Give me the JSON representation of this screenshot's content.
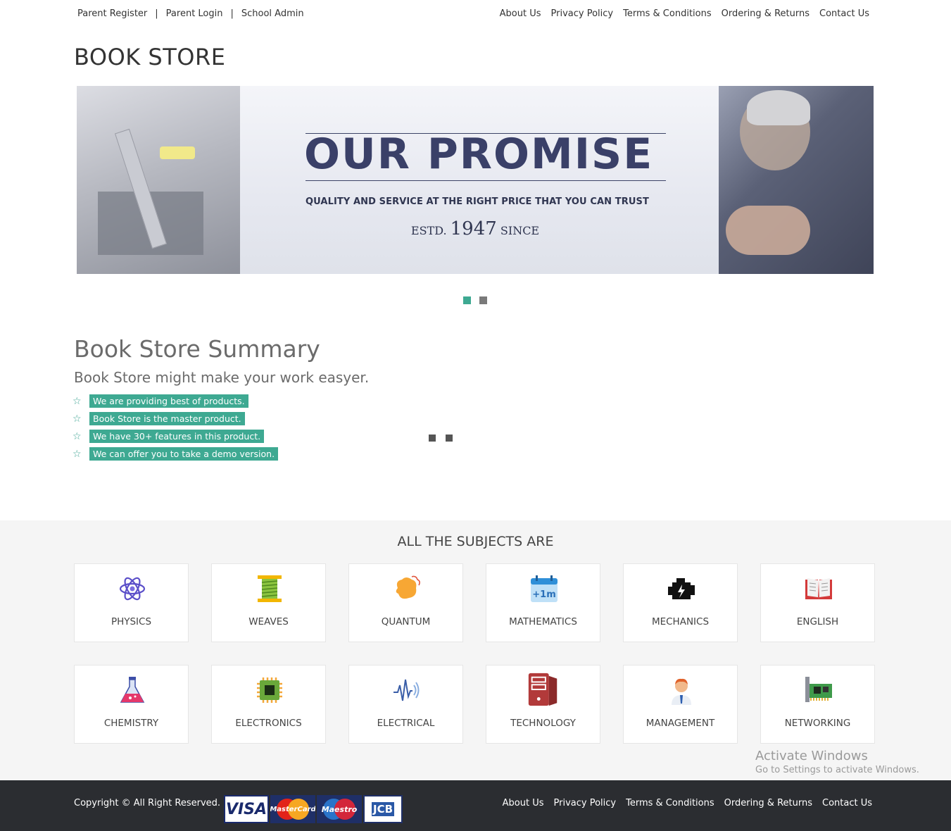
{
  "topbar": {
    "left_links": [
      "Parent Register",
      "Parent Login",
      "School Admin"
    ],
    "separator": "|",
    "right_links": [
      "About Us",
      "Privacy Policy",
      "Terms & Conditions",
      "Ordering & Returns",
      "Contact Us"
    ]
  },
  "brand": "BOOK STORE",
  "banner": {
    "headline": "OUR PROMISE",
    "tagline": "QUALITY AND SERVICE AT THE RIGHT PRICE THAT YOU CAN TRUST",
    "estd_prefix": "ESTD.",
    "year": "1947",
    "estd_suffix": "SINCE",
    "slide_count": 2,
    "active_slide": 1,
    "colors": {
      "active_dot": "#3ea992",
      "inactive_dot": "#7a7a7a"
    }
  },
  "summary": {
    "title": "Book Store Summary",
    "subtitle": "Book Store might make your work easyer.",
    "features": [
      "We are providing best of products.",
      "Book Store is the master product.",
      "We have 30+ features in this product.",
      "We can offer you to take a demo version."
    ],
    "accent": "#3ea992"
  },
  "subjects": {
    "title": "ALL THE SUBJECTS ARE",
    "items": [
      {
        "label": "PHYSICS",
        "icon": "atom-icon"
      },
      {
        "label": "WEAVES",
        "icon": "spool-icon"
      },
      {
        "label": "QUANTUM",
        "icon": "splash-icon"
      },
      {
        "label": "MATHEMATICS",
        "icon": "calendar-plus-icon",
        "icon_text": "+1m"
      },
      {
        "label": "MECHANICS",
        "icon": "engine-icon"
      },
      {
        "label": "ENGLISH",
        "icon": "open-book-icon"
      },
      {
        "label": "CHEMISTRY",
        "icon": "flask-icon"
      },
      {
        "label": "ELECTRONICS",
        "icon": "chip-icon"
      },
      {
        "label": "ELECTRICAL",
        "icon": "signal-wave-icon"
      },
      {
        "label": "TECHNOLOGY",
        "icon": "server-icon"
      },
      {
        "label": "MANAGEMENT",
        "icon": "manager-icon"
      },
      {
        "label": "NETWORKING",
        "icon": "network-card-icon"
      }
    ]
  },
  "watermark": {
    "line1": "Activate Windows",
    "line2": "Go to Settings to activate Windows."
  },
  "footer": {
    "copyright": "Copyright © All Right Reserved.",
    "payment_cards": [
      "VISA",
      "MasterCard",
      "Maestro",
      "JCB"
    ],
    "links": [
      "About Us",
      "Privacy Policy",
      "Terms & Conditions",
      "Ordering & Returns",
      "Contact Us"
    ]
  }
}
